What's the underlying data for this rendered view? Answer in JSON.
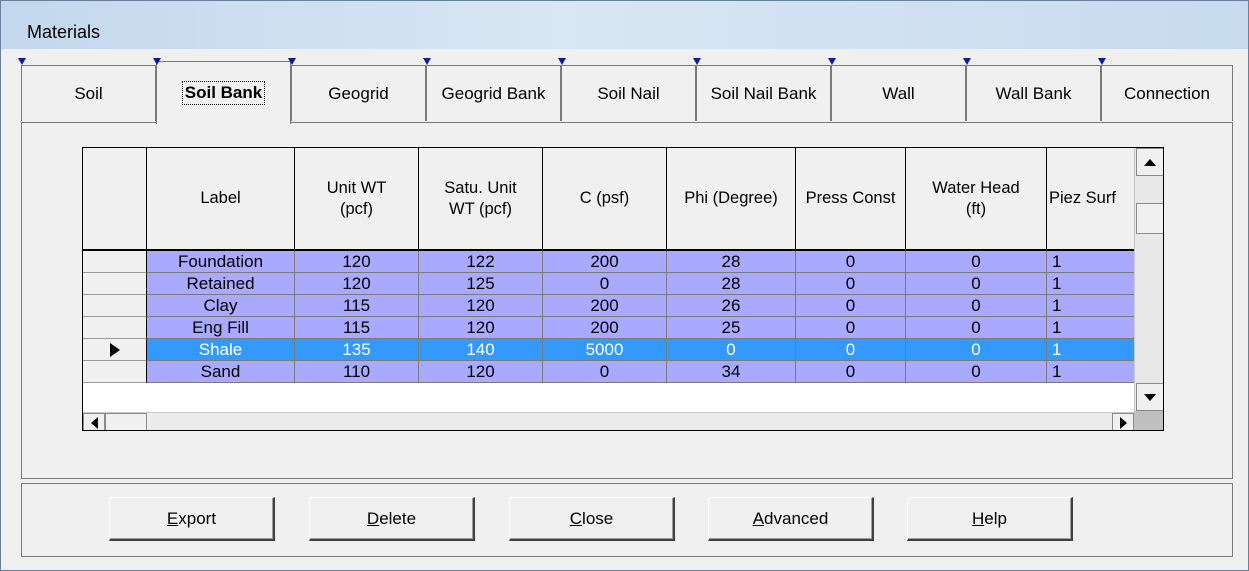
{
  "window": {
    "title": "Materials"
  },
  "tabs": [
    {
      "label": "Soil",
      "active": false
    },
    {
      "label": "Soil Bank",
      "active": true
    },
    {
      "label": "Geogrid",
      "active": false
    },
    {
      "label": "Geogrid Bank",
      "active": false
    },
    {
      "label": "Soil Nail",
      "active": false
    },
    {
      "label": "Soil Nail Bank",
      "active": false
    },
    {
      "label": "Wall",
      "active": false
    },
    {
      "label": "Wall Bank",
      "active": false
    },
    {
      "label": "Connection",
      "active": false
    }
  ],
  "grid": {
    "columns": [
      "Label",
      "Unit WT\n(pcf)",
      "Satu. Unit\nWT (pcf)",
      "C (psf)",
      "Phi (Degree)",
      "Press Const",
      "Water  Head\n(ft)",
      "Piez Surf"
    ],
    "selected_row": 4,
    "rows": [
      [
        "Foundation",
        "120",
        "122",
        "200",
        "28",
        "0",
        "0",
        "1"
      ],
      [
        "Retained",
        "120",
        "125",
        "0",
        "28",
        "0",
        "0",
        "1"
      ],
      [
        "Clay",
        "115",
        "120",
        "200",
        "26",
        "0",
        "0",
        "1"
      ],
      [
        "Eng Fill",
        "115",
        "120",
        "200",
        "25",
        "0",
        "0",
        "1"
      ],
      [
        "Shale",
        "135",
        "140",
        "5000",
        "0",
        "0",
        "0",
        "1"
      ],
      [
        "Sand",
        "110",
        "120",
        "0",
        "34",
        "0",
        "0",
        "1"
      ]
    ]
  },
  "buttons": [
    {
      "name": "export-button",
      "access": "E",
      "rest": "xport"
    },
    {
      "name": "delete-button",
      "access": "D",
      "rest": "elete"
    },
    {
      "name": "close-button",
      "access": "C",
      "rest": "lose"
    },
    {
      "name": "advanced-button",
      "access": "A",
      "rest": "dvanced"
    },
    {
      "name": "help-button",
      "access": "H",
      "rest": "elp"
    }
  ],
  "colors": {
    "row_bg": "#a9a9ff",
    "selected_bg": "#3399ff",
    "tab_marker": "#0b1aa3"
  }
}
